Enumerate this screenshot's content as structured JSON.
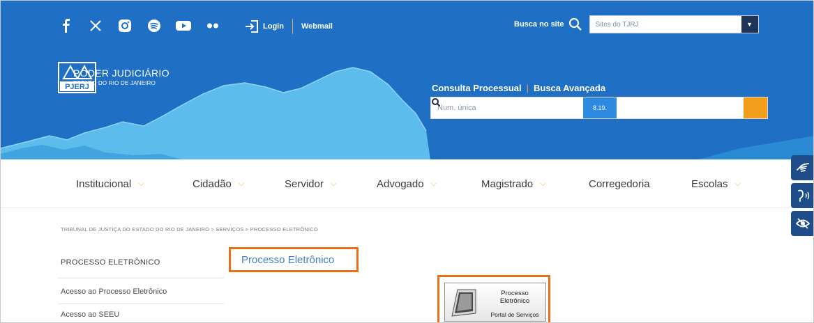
{
  "topbar": {
    "social_icons": [
      "facebook-icon",
      "x-icon",
      "instagram-icon",
      "spotify-icon",
      "youtube-icon",
      "flickr-icon"
    ],
    "login_label": "Login",
    "webmail_label": "Webmail",
    "search_label": "Busca no site",
    "site_select_value": "Sites do TJRJ"
  },
  "hero": {
    "logo_abbrev": "PJERJ",
    "logo_title": "PODER JUDICIÁRIO",
    "logo_subtitle": "ESTADO DO RIO DE JANEIRO",
    "consulta_label": "Consulta Processual",
    "busca_avancada_label": "Busca Avançada",
    "process_placeholder": "Num. única",
    "tag_label": "8.19."
  },
  "nav": {
    "items": [
      {
        "label": "Institucional",
        "dropdown": true
      },
      {
        "label": "Cidadão",
        "dropdown": true
      },
      {
        "label": "Servidor",
        "dropdown": true
      },
      {
        "label": "Advogado",
        "dropdown": true
      },
      {
        "label": "Magistrado",
        "dropdown": true
      },
      {
        "label": "Corregedoria",
        "dropdown": false
      },
      {
        "label": "Escolas",
        "dropdown": true
      }
    ]
  },
  "content": {
    "breadcrumb": "TRIBUNAL DE JUSTIÇA DO ESTADO DO RIO DE JANEIRO > SERVIÇOS > PROCESSO ELETRÔNICO",
    "sidebar_title": "PROCESSO ELETRÔNICO",
    "sidebar_links": [
      "Acesso ao Processo Eletrônico",
      "Acesso ao SEEU"
    ],
    "page_heading": "Processo Eletrônico",
    "portal_line1": "Processo",
    "portal_line2": "Eletrônico",
    "portal_subtitle": "Portal de Serviços"
  },
  "colors": {
    "brand_blue": "#1f6fc5",
    "accent_orange": "#f0a43a",
    "highlight_orange": "#ea6f18"
  }
}
